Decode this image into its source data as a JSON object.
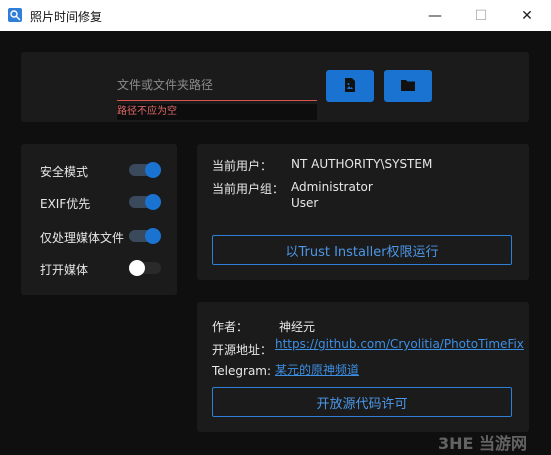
{
  "window": {
    "title": "照片时间修复",
    "minimize": "—",
    "maximize": "☐",
    "close": "✕"
  },
  "path": {
    "placeholder": "文件或文件夹路径",
    "value": "",
    "error": "路径不应为空",
    "file_button_icon": "image-file-icon",
    "folder_button_icon": "folder-icon"
  },
  "options": [
    {
      "label": "安全模式",
      "on": true
    },
    {
      "label": "EXIF优先",
      "on": true
    },
    {
      "label": "仅处理媒体文件",
      "on": true
    },
    {
      "label": "打开媒体",
      "on": false
    }
  ],
  "user": {
    "current_user_label": "当前用户：",
    "current_user_value": "NT AUTHORITY\\SYSTEM",
    "group_label": "当前用户组：",
    "group_values": [
      "Administrator",
      "User"
    ],
    "run_button": "以Trust Installer权限运行"
  },
  "about": {
    "author_label": "作者：",
    "author_value": "神经元",
    "source_label": "开源地址：",
    "source_link": "https://github.com/Cryolitia/PhotoTimeFix",
    "telegram_label": "Telegram:",
    "telegram_link": "某元的原神频道",
    "license_button": "开放源代码许可"
  },
  "watermark": "3HE 当游网",
  "colors": {
    "accent": "#1a73d1",
    "error": "#e06a6a",
    "background": "#0f0f0f",
    "panel": "#1b1b1b"
  }
}
